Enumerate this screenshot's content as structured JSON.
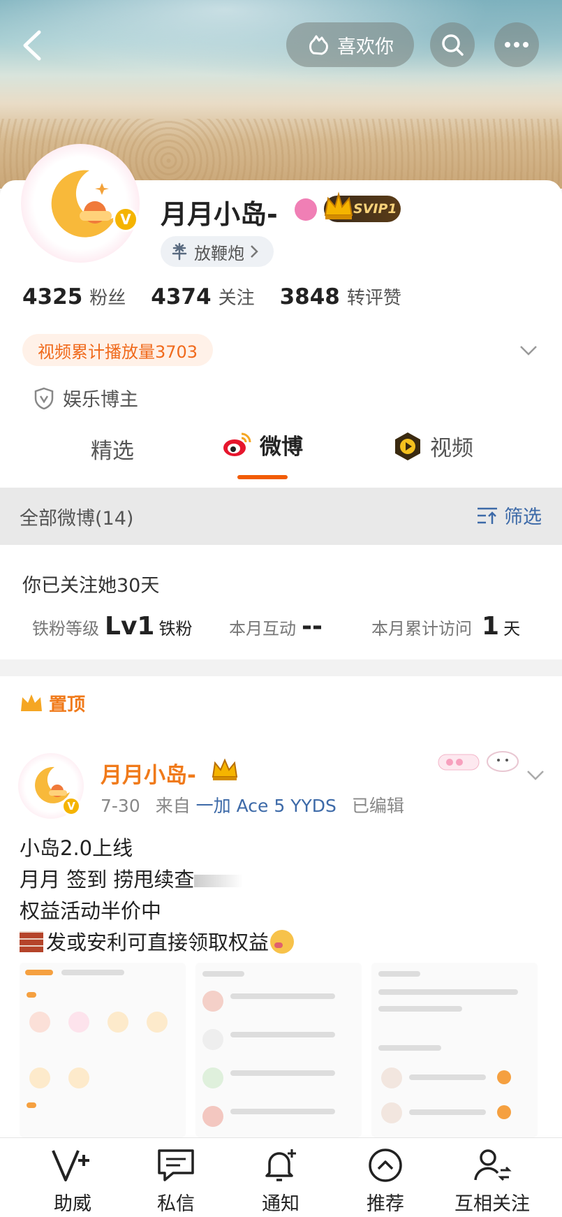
{
  "header": {
    "like_label": "喜欢你"
  },
  "profile": {
    "name": "月月小岛-",
    "svip_label": "SVIP1",
    "tag_label": "放鞭炮",
    "stats": [
      {
        "num": "4325",
        "label": "粉丝"
      },
      {
        "num": "4374",
        "label": "关注"
      },
      {
        "num": "3848",
        "label": "转评赞"
      }
    ],
    "play_count": "视频累计播放量3703",
    "certification": "娱乐博主"
  },
  "tabs": [
    "精选",
    "微博",
    "视频"
  ],
  "feed": {
    "all_label": "全部微博(14)",
    "filter_label": "筛选"
  },
  "follow_card": {
    "title": "你已关注她30天",
    "fan_level_label": "铁粉等级",
    "fan_level_value": "Lv1",
    "fan_level_suffix": "铁粉",
    "monthly_interaction_label": "本月互动",
    "monthly_interaction_value": "--",
    "monthly_visits_label": "本月累计访问",
    "monthly_visits_value": "1",
    "monthly_visits_unit": "天"
  },
  "post": {
    "pinned_label": "置顶",
    "author": "月月小岛-",
    "date": "7-30",
    "from_label": "来自",
    "device": "一加 Ace 5 YYDS",
    "edited_label": "已编辑",
    "lines": [
      "小岛2.0上线",
      "月月 签到 捞甩续查",
      "权益活动半价中",
      "发或安利可直接领取权益"
    ]
  },
  "bottom_nav": [
    "助威",
    "私信",
    "通知",
    "推荐",
    "互相关注"
  ],
  "colors": {
    "accent": "#f25c05",
    "orange_text": "#f07a1a",
    "link_blue": "#3d6aa8"
  }
}
